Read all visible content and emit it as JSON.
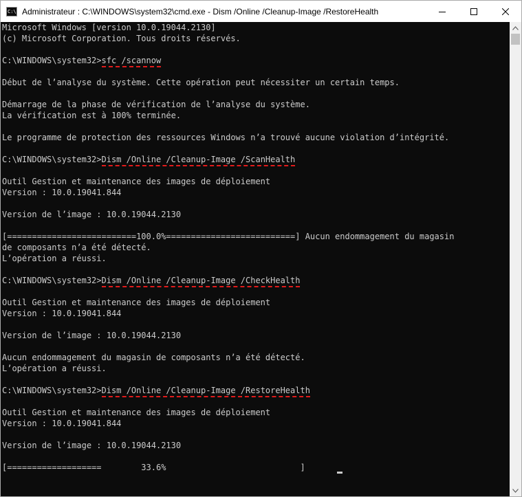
{
  "window": {
    "title": "Administrateur : C:\\WINDOWS\\system32\\cmd.exe - Dism  /Online /Cleanup-Image /RestoreHealth",
    "icon": "cmd-icon",
    "icon_label": "C:\\",
    "controls": [
      "minimize-icon",
      "maximize-icon",
      "close-icon"
    ]
  },
  "terminal": {
    "lines": [
      {
        "text": "Microsoft Windows [version 10.0.19044.2130]"
      },
      {
        "text": "(c) Microsoft Corporation. Tous droits réservés."
      },
      {
        "text": ""
      },
      {
        "prompt": "C:\\WINDOWS\\system32>",
        "command": "sfc /scannow"
      },
      {
        "text": ""
      },
      {
        "text": "Début de l’analyse du système. Cette opération peut nécessiter un certain temps."
      },
      {
        "text": ""
      },
      {
        "text": "Démarrage de la phase de vérification de l’analyse du système."
      },
      {
        "text": "La vérification est à 100% terminée."
      },
      {
        "text": ""
      },
      {
        "text": "Le programme de protection des ressources Windows n’a trouvé aucune violation d’intégrité."
      },
      {
        "text": ""
      },
      {
        "prompt": "C:\\WINDOWS\\system32>",
        "command": "Dism /Online /Cleanup-Image /ScanHealth"
      },
      {
        "text": ""
      },
      {
        "text": "Outil Gestion et maintenance des images de déploiement"
      },
      {
        "text": "Version : 10.0.19041.844"
      },
      {
        "text": ""
      },
      {
        "text": "Version de l’image : 10.0.19044.2130"
      },
      {
        "text": ""
      },
      {
        "text": "[==========================100.0%==========================] Aucun endommagement du magasin"
      },
      {
        "text": "de composants n’a été détecté."
      },
      {
        "text": "L’opération a réussi."
      },
      {
        "text": ""
      },
      {
        "prompt": "C:\\WINDOWS\\system32>",
        "command": "Dism /Online /Cleanup-Image /CheckHealth"
      },
      {
        "text": ""
      },
      {
        "text": "Outil Gestion et maintenance des images de déploiement"
      },
      {
        "text": "Version : 10.0.19041.844"
      },
      {
        "text": ""
      },
      {
        "text": "Version de l’image : 10.0.19044.2130"
      },
      {
        "text": ""
      },
      {
        "text": "Aucun endommagement du magasin de composants n’a été détecté."
      },
      {
        "text": "L’opération a réussi."
      },
      {
        "text": ""
      },
      {
        "prompt": "C:\\WINDOWS\\system32>",
        "command": "Dism /Online /Cleanup-Image /RestoreHealth"
      },
      {
        "text": ""
      },
      {
        "text": "Outil Gestion et maintenance des images de déploiement"
      },
      {
        "text": "Version : 10.0.19041.844"
      },
      {
        "text": ""
      },
      {
        "text": "Version de l’image : 10.0.19044.2130"
      },
      {
        "text": ""
      },
      {
        "text": "[===================        33.6%                           ] "
      }
    ]
  },
  "colors": {
    "terminal_bg": "#0c0c0c",
    "terminal_fg": "#cccccc",
    "highlight_underline": "#e21b1b"
  }
}
